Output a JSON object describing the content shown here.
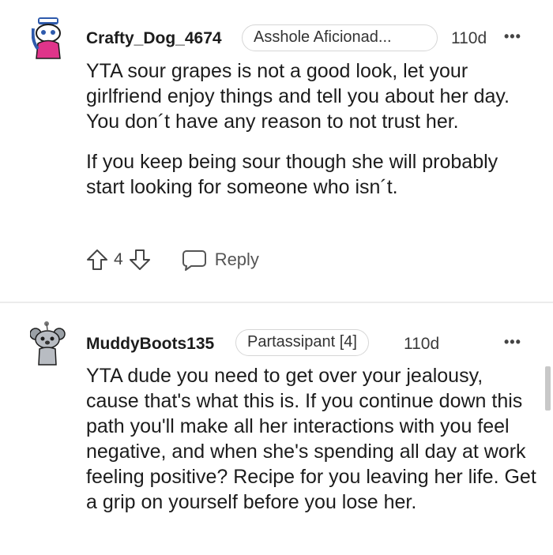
{
  "comments": [
    {
      "username": "Crafty_Dog_4674",
      "flair": "Asshole Aficionad...",
      "time": "110d",
      "more": "•••",
      "paragraphs": [
        "YTA sour grapes is not a good look, let your girlfriend enjoy things and tell you about her day. You don´t have any reason to not trust her.",
        "If you keep being sour though she will probably start looking for someone who isn´t."
      ],
      "score": "4",
      "reply_label": "Reply"
    },
    {
      "username": "MuddyBoots135",
      "flair": "Partassipant [4]",
      "time": "110d",
      "more": "•••",
      "paragraphs": [
        "YTA dude you need to get over your jealousy, cause that's what this is. If you continue down this path you'll make all her interactions with you feel negative, and when she's spending all day at work feeling positive? Recipe for you leaving her life. Get a grip on yourself before you lose her."
      ]
    }
  ],
  "icons": {
    "avatar1": "snoo-avatar-sailor",
    "avatar2": "snoo-avatar-koala",
    "upvote": "arrow-up-outline-icon",
    "downvote": "arrow-down-outline-icon",
    "reply": "speech-bubble-icon",
    "more": "ellipsis-icon"
  },
  "colors": {
    "text": "#1c1c1c",
    "secondary": "#444444",
    "flair_border": "#d6d6d6",
    "avatar1_hat": "#2e5aac",
    "avatar1_body": "#e0348a"
  }
}
